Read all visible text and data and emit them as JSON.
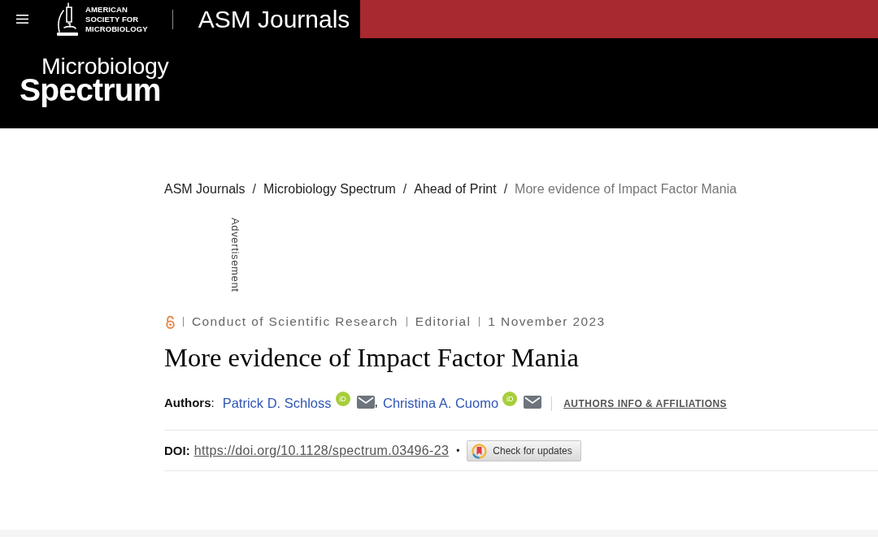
{
  "header": {
    "society_logo": {
      "lines": [
        "AMERICAN",
        "SOCIETY FOR",
        "MICROBIOLOGY"
      ]
    },
    "site_title": "ASM Journals",
    "journal_logo": {
      "line_1": "Microbiology",
      "line_2": "Spectrum"
    }
  },
  "breadcrumb": {
    "items": [
      {
        "label": "ASM Journals",
        "current": false
      },
      {
        "label": "Microbiology Spectrum",
        "current": false
      },
      {
        "label": "Ahead of Print",
        "current": false
      },
      {
        "label": "More evidence of Impact Factor Mania",
        "current": true
      }
    ],
    "separators": [
      "/",
      "/",
      "/"
    ]
  },
  "advertisement": {
    "label": "Advertisement"
  },
  "article": {
    "open_access": true,
    "meta": [
      "Conduct of Scientific Research",
      "Editorial",
      "1 November 2023"
    ],
    "title": "More evidence of Impact Factor Mania",
    "authors_label": "**Authors**:",
    "authors": [
      {
        "name": "Patrick D. Schloss",
        "orcid_badge": "iD"
      },
      {
        "name": "Christina A. Cuomo",
        "orcid_badge": "iD"
      }
    ],
    "author_separators": [
      ","
    ],
    "affiliations_link": "AUTHORS INFO & AFFILIATIONS",
    "doi_label": "DOI:",
    "doi_link": "https://doi.org/10.1128/spectrum.03496-23",
    "doi_bullet": "•",
    "check_updates_button": "Check for updates"
  }
}
